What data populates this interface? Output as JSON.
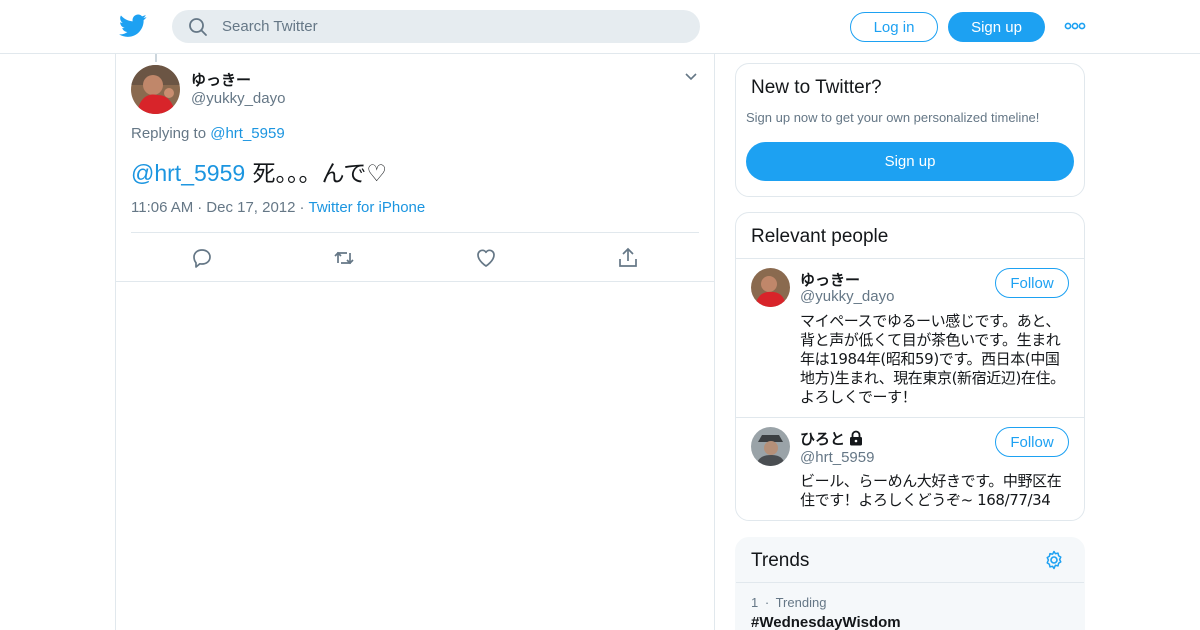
{
  "header": {
    "search_placeholder": "Search Twitter",
    "login_label": "Log in",
    "signup_label": "Sign up",
    "brand_color": "#1da1f2"
  },
  "tweet": {
    "display_name": "ゆっきー",
    "handle": "@yukky_dayo",
    "replying_prefix": "Replying to",
    "replying_to": "@hrt_5959",
    "text_mention": "@hrt_5959",
    "text_body": " 死。。。んで♡",
    "time": "11:06 AM",
    "date": "Dec 17, 2012",
    "source": "Twitter for iPhone",
    "actions": [
      "reply-icon",
      "retweet-icon",
      "like-icon",
      "share-icon"
    ]
  },
  "new_to_twitter": {
    "title": "New to Twitter?",
    "subtitle": "Sign up now to get your own personalized timeline!",
    "signup_label": "Sign up"
  },
  "relevant_people": {
    "title": "Relevant people",
    "people": [
      {
        "name": "ゆっきー",
        "handle": "@yukky_dayo",
        "follow_label": "Follow",
        "bio": "マイペースでゆるーい感じです。あと、背と声が低くて目が茶色いです。生まれ年は1984年(昭和59)です。西日本(中国地方)生まれ、現在東京(新宿近辺)在住。よろしくでーす！"
      },
      {
        "name": "ひろと",
        "handle": "@hrt_5959",
        "follow_label": "Follow",
        "protected": true,
        "bio": "ビール、らーめん大好きです。中野区在住です！よろしくどうぞ~ 168/77/34"
      }
    ]
  },
  "trends": {
    "title": "Trends",
    "items": [
      {
        "rank": "1",
        "label": "Trending",
        "name": "#WednesdayWisdom"
      }
    ]
  }
}
